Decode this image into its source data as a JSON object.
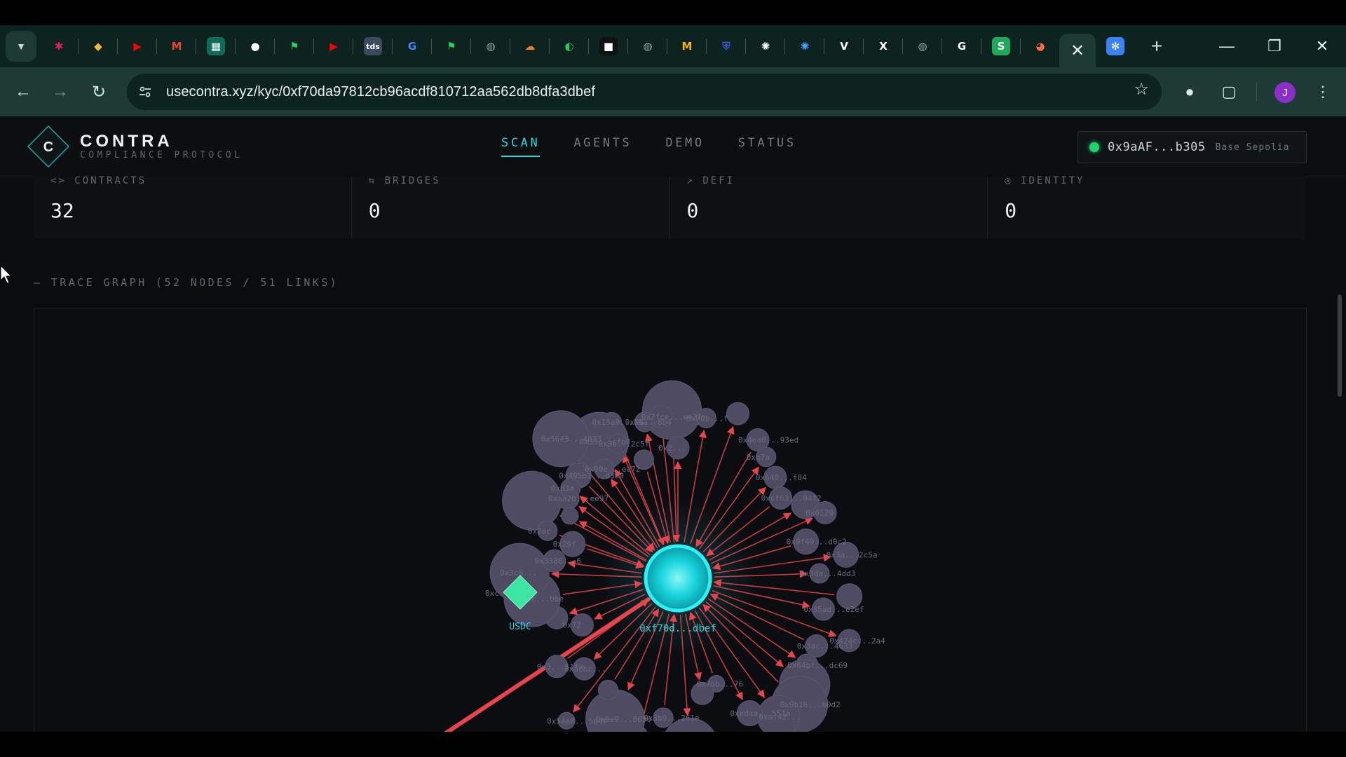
{
  "browser": {
    "tabs": [
      {
        "icon": "slack-icon",
        "color": "#e01e5a",
        "glyph": "✱"
      },
      {
        "icon": "binance-icon",
        "color": "#f3ba2f",
        "glyph": "◆"
      },
      {
        "icon": "youtube-icon",
        "color": "#ff0000",
        "glyph": "▶"
      },
      {
        "icon": "gmail-icon",
        "color": "#ea4335",
        "glyph": "M"
      },
      {
        "icon": "sheet-icon",
        "color": "#0f6b5a",
        "glyph": "▦"
      },
      {
        "icon": "github-icon",
        "color": "#ffffff",
        "glyph": "●"
      },
      {
        "icon": "flag-icon",
        "color": "#1ed760",
        "glyph": "⚑"
      },
      {
        "icon": "youtube-icon",
        "color": "#ff0000",
        "glyph": "▶"
      },
      {
        "icon": "tds-icon",
        "color": "#3b4a5c",
        "glyph": "tds"
      },
      {
        "icon": "google-icon",
        "color": "#4285f4",
        "glyph": "G"
      },
      {
        "icon": "flag-icon",
        "color": "#1ed760",
        "glyph": "⚑"
      },
      {
        "icon": "globe-icon",
        "color": "#9aa5a2",
        "glyph": "◍"
      },
      {
        "icon": "cloudflare-icon",
        "color": "#f38020",
        "glyph": "☁"
      },
      {
        "icon": "pie-icon",
        "color": "#22cc66",
        "glyph": "◐"
      },
      {
        "icon": "square-icon",
        "color": "#111111",
        "glyph": "■"
      },
      {
        "icon": "globe-icon",
        "color": "#9aa5a2",
        "glyph": "◍"
      },
      {
        "icon": "m-icon",
        "color": "#f5b50a",
        "glyph": "M"
      },
      {
        "icon": "shield-icon",
        "color": "#3a5bd9",
        "glyph": "⛨"
      },
      {
        "icon": "openai-icon",
        "color": "#ffffff",
        "glyph": "✺"
      },
      {
        "icon": "openai-icon",
        "color": "#4aa3ff",
        "glyph": "✺"
      },
      {
        "icon": "v-icon",
        "color": "#ffffff",
        "glyph": "V"
      },
      {
        "icon": "x-icon",
        "color": "#ffffff",
        "glyph": "X"
      },
      {
        "icon": "globe-icon",
        "color": "#9aa5a2",
        "glyph": "◍"
      },
      {
        "icon": "g-icon",
        "color": "#ffffff",
        "glyph": "G"
      },
      {
        "icon": "s-icon",
        "color": "#1faa59",
        "glyph": "S"
      },
      {
        "icon": "gradient-icon",
        "color": "#ff6a3d",
        "glyph": "◕"
      }
    ],
    "active_tab_icon": "close-icon",
    "after_tab_icon": {
      "icon": "snowflake-icon",
      "color": "#3b82f6",
      "glyph": "✻"
    },
    "url": "usecontra.xyz/kyc/0xf70da97812cb96acdf810712aa562db8dfa3dbef",
    "avatar_letter": "J"
  },
  "site": {
    "logo_letter": "C",
    "logo_name": "CONTRA",
    "logo_sub": "COMPLIANCE PROTOCOL",
    "nav": [
      "SCAN",
      "AGENTS",
      "DEMO",
      "STATUS"
    ],
    "active_nav": "SCAN",
    "wallet_address": "0x9aAF...b305",
    "wallet_network": "Base Sepolia",
    "stats": [
      {
        "label": "CONTRACTS",
        "icon": "code-icon",
        "value": "32"
      },
      {
        "label": "BRIDGES",
        "icon": "bridge-icon",
        "value": "0"
      },
      {
        "label": "DEFI",
        "icon": "trend-icon",
        "value": "0"
      },
      {
        "label": "IDENTITY",
        "icon": "fingerprint-icon",
        "value": "0"
      }
    ],
    "section_title": "— TRACE GRAPH (52 NODES / 51 LINKS)",
    "graph": {
      "center_label": "0xf70d...dbef",
      "usdc_label": "USDC",
      "usdc_prefix": "0xc",
      "colors": {
        "center": "#1fe5ea",
        "node": "#4e4b63",
        "link": "#e8444d",
        "usdc": "#3ce6a2"
      },
      "node_labels": [
        "0x15a0...b1a",
        "0x640...f84",
        "0x3a...2c5a",
        "0x3ac...4633",
        "0xedaa...551a",
        "0xfeea...92a",
        "0x3...51fa",
        "0x3380...6",
        "0x90e...ee72",
        "0x5643...4d33",
        "0x70b...f",
        "0x4ea0...93ed",
        "0x0129",
        "0x35ad...e2ef",
        "0x9b16...b0d2",
        "0x5901...6e35",
        "0x54a0...5b4f",
        "0x19c...bbe",
        "0xaa2b...ee97",
        "0x2fce...ee2f",
        "0x2ac",
        "0x35...cfb8",
        "0xcf63...04f2",
        "0x3da...4dd3",
        "0x64bf...dc69",
        "0x76b...76",
        "0x9e9...8056",
        "0x72",
        "0x29f",
        "0x3e...2c5f",
        "0xd3e",
        "0x96...8b4",
        "0xb7a",
        "0x9f49...d0c2",
        "0x474c...2a4",
        "0xaf42...",
        "0x3b9...261e",
        "0xacbc...",
        "0x3c6...",
        "0x495b1...d3e9",
        "0x2..."
      ]
    }
  }
}
